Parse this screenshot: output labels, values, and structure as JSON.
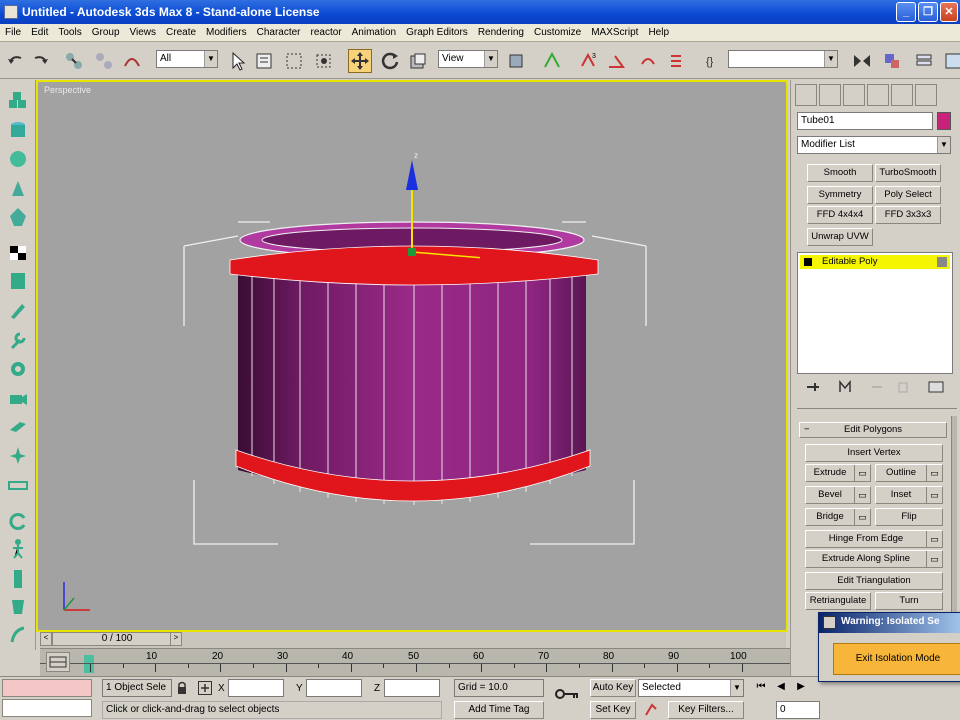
{
  "window": {
    "title": "Untitled  - Autodesk 3ds Max 8   - Stand-alone License",
    "controls": [
      "minimize",
      "maximize",
      "close"
    ]
  },
  "menu": [
    "File",
    "Edit",
    "Tools",
    "Group",
    "Views",
    "Create",
    "Modifiers",
    "Character",
    "reactor",
    "Animation",
    "Graph Editors",
    "Rendering",
    "Customize",
    "MAXScript",
    "Help"
  ],
  "toolbar": {
    "selection_filter": "All",
    "reference_coord": "View",
    "named_selection": ""
  },
  "viewport": {
    "label": "Perspective"
  },
  "command_panel": {
    "object_name": "Tube01",
    "object_color": "#c8237a",
    "modifier_list_label": "Modifier List",
    "modifier_buttons": [
      "Smooth",
      "TurboSmooth",
      "Symmetry",
      "Poly Select",
      "FFD 4x4x4",
      "FFD 3x3x3",
      "Unwrap UVW"
    ],
    "stack_item": "Editable Poly",
    "rollout_title": "Edit Polygons",
    "edit_polygons": {
      "insert_vertex": "Insert Vertex",
      "extrude": "Extrude",
      "outline": "Outline",
      "bevel": "Bevel",
      "inset": "Inset",
      "bridge": "Bridge",
      "flip": "Flip",
      "hinge_from_edge": "Hinge From Edge",
      "extrude_along_spline": "Extrude Along Spline",
      "edit_triangulation": "Edit Triangulation",
      "retriangulate": "Retriangulate",
      "turn": "Turn"
    }
  },
  "time": {
    "slider_label": "0 / 100",
    "ticks": [
      "10",
      "20",
      "30",
      "40",
      "50",
      "60",
      "70",
      "80",
      "90",
      "100"
    ]
  },
  "status": {
    "selection_count": "1 Object Sele",
    "x_label": "X",
    "y_label": "Y",
    "z_label": "Z",
    "x_value": "",
    "y_value": "",
    "z_value": "",
    "grid": "Grid = 10.0",
    "prompt": "Click or click-and-drag to select objects",
    "add_time_tag": "Add Time Tag",
    "auto_key": "Auto Key",
    "set_key": "Set Key",
    "key_mode": "Selected",
    "key_filters": "Key Filters...",
    "frame": "0"
  },
  "isolation": {
    "title": "Warning: Isolated Se",
    "button": "Exit Isolation Mode"
  },
  "colors": {
    "tube_body": "#8a2178",
    "tube_ring": "#e0161c",
    "viewport_border": "#e8e400",
    "stack_highlight": "#f5f500",
    "isolation_button": "#f7b63a"
  }
}
